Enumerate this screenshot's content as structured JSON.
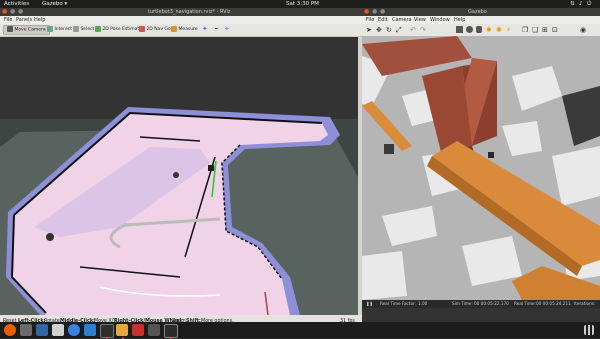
{
  "topbar": {
    "activities": "Activities",
    "app": "Gazebo",
    "clock": "Sat  3:30 PM",
    "icons": [
      "network-icon",
      "volume-icon",
      "power-icon",
      "chevron-down-icon"
    ]
  },
  "rviz": {
    "title": "turtlebot3_navigation.rviz* - RViz",
    "menu": [
      "File",
      "Panels",
      "Help"
    ],
    "tools": [
      "Move Camera",
      "Interact",
      "Select",
      "2D Pose Estimate",
      "2D Nav Goal",
      "Measure"
    ],
    "status": {
      "reset": "Reset",
      "hint_left_key": "Left-Click:",
      "hint_left": "Rotate.",
      "hint_mid_key": "Middle-Click:",
      "hint_mid": "Move X/Y.",
      "hint_right_key": "Right-Click/Mouse Wheel:",
      "hint_right": "Zoom.",
      "hint_shift_key": "Shift:",
      "hint_shift": "More options.",
      "fps": "31 fps"
    }
  },
  "gazebo": {
    "title": "Gazebo",
    "menu": [
      "File",
      "Edit",
      "Camera",
      "View",
      "Window",
      "Help"
    ],
    "status": {
      "rtf_label": "Real Time Factor:",
      "rtf_value": "1.00",
      "sim_label": "Sim Time:",
      "sim_value": "00 00:05:22.170",
      "real_label": "Real Time:",
      "real_value": "00 00:05:24.211",
      "iter_label": "Iterations:"
    }
  },
  "colors": {
    "ubuntu_orange": "#e95420",
    "costmap_pink": "#f3d4e6",
    "costmap_blue": "#8a8ad8",
    "brick": "#9b4a3a",
    "wood": "#d98c3c"
  }
}
